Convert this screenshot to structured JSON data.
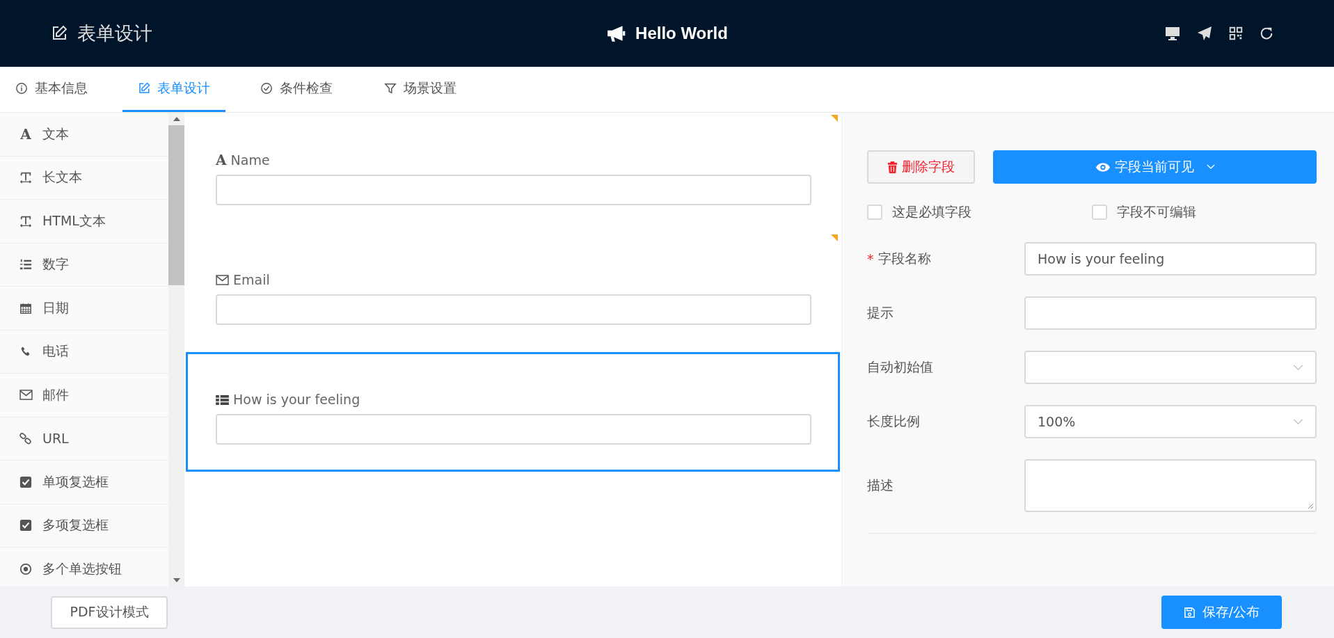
{
  "header": {
    "title": "表单设计",
    "form_name": "Hello World",
    "actions": [
      {
        "kind": "desktop"
      },
      {
        "kind": "send"
      },
      {
        "kind": "qrcode"
      },
      {
        "kind": "refresh"
      }
    ]
  },
  "tabs": [
    {
      "label": "基本信息",
      "kind": "info",
      "selected": false
    },
    {
      "label": "表单设计",
      "kind": "edit",
      "selected": true
    },
    {
      "label": "条件检查",
      "kind": "check",
      "selected": false
    },
    {
      "label": "场景设置",
      "kind": "filter",
      "selected": false
    }
  ],
  "palette": [
    {
      "label": "文本",
      "kind": "font",
      "glyph": "A"
    },
    {
      "label": "长文本",
      "kind": "textsize"
    },
    {
      "label": "HTML文本",
      "kind": "textsize"
    },
    {
      "label": "数字",
      "kind": "numlist"
    },
    {
      "label": "日期",
      "kind": "calendar"
    },
    {
      "label": "电话",
      "kind": "phone"
    },
    {
      "label": "邮件",
      "kind": "mail"
    },
    {
      "label": "URL",
      "kind": "link"
    },
    {
      "label": "单项复选框",
      "kind": "checkbox"
    },
    {
      "label": "多项复选框",
      "kind": "checkbox"
    },
    {
      "label": "多个单选按钮",
      "kind": "radio"
    }
  ],
  "canvas_fields": [
    {
      "label": "Name",
      "kind": "font",
      "glyph": "A",
      "flagged": true,
      "selected": false
    },
    {
      "label": "Email",
      "kind": "mail",
      "flagged": true,
      "selected": false
    },
    {
      "label": "How is your feeling",
      "kind": "list",
      "flagged": false,
      "selected": true
    }
  ],
  "properties": {
    "delete_button": "删除字段",
    "visibility_button": "字段当前可见",
    "checkboxes": [
      {
        "label": "这是必填字段",
        "checked": false
      },
      {
        "label": "字段不可编辑",
        "checked": false
      }
    ],
    "rows": [
      {
        "label": "字段名称",
        "kind": "input",
        "required_mark": "*",
        "value": "How is your feeling"
      },
      {
        "label": "提示",
        "kind": "input"
      },
      {
        "label": "自动初始值",
        "kind": "select"
      },
      {
        "label": "长度比例",
        "kind": "select",
        "value": "100%"
      },
      {
        "label": "描述",
        "kind": "textarea"
      }
    ]
  },
  "footer": {
    "pdf_button": "PDF设计模式",
    "save_button": "保存/公布"
  }
}
